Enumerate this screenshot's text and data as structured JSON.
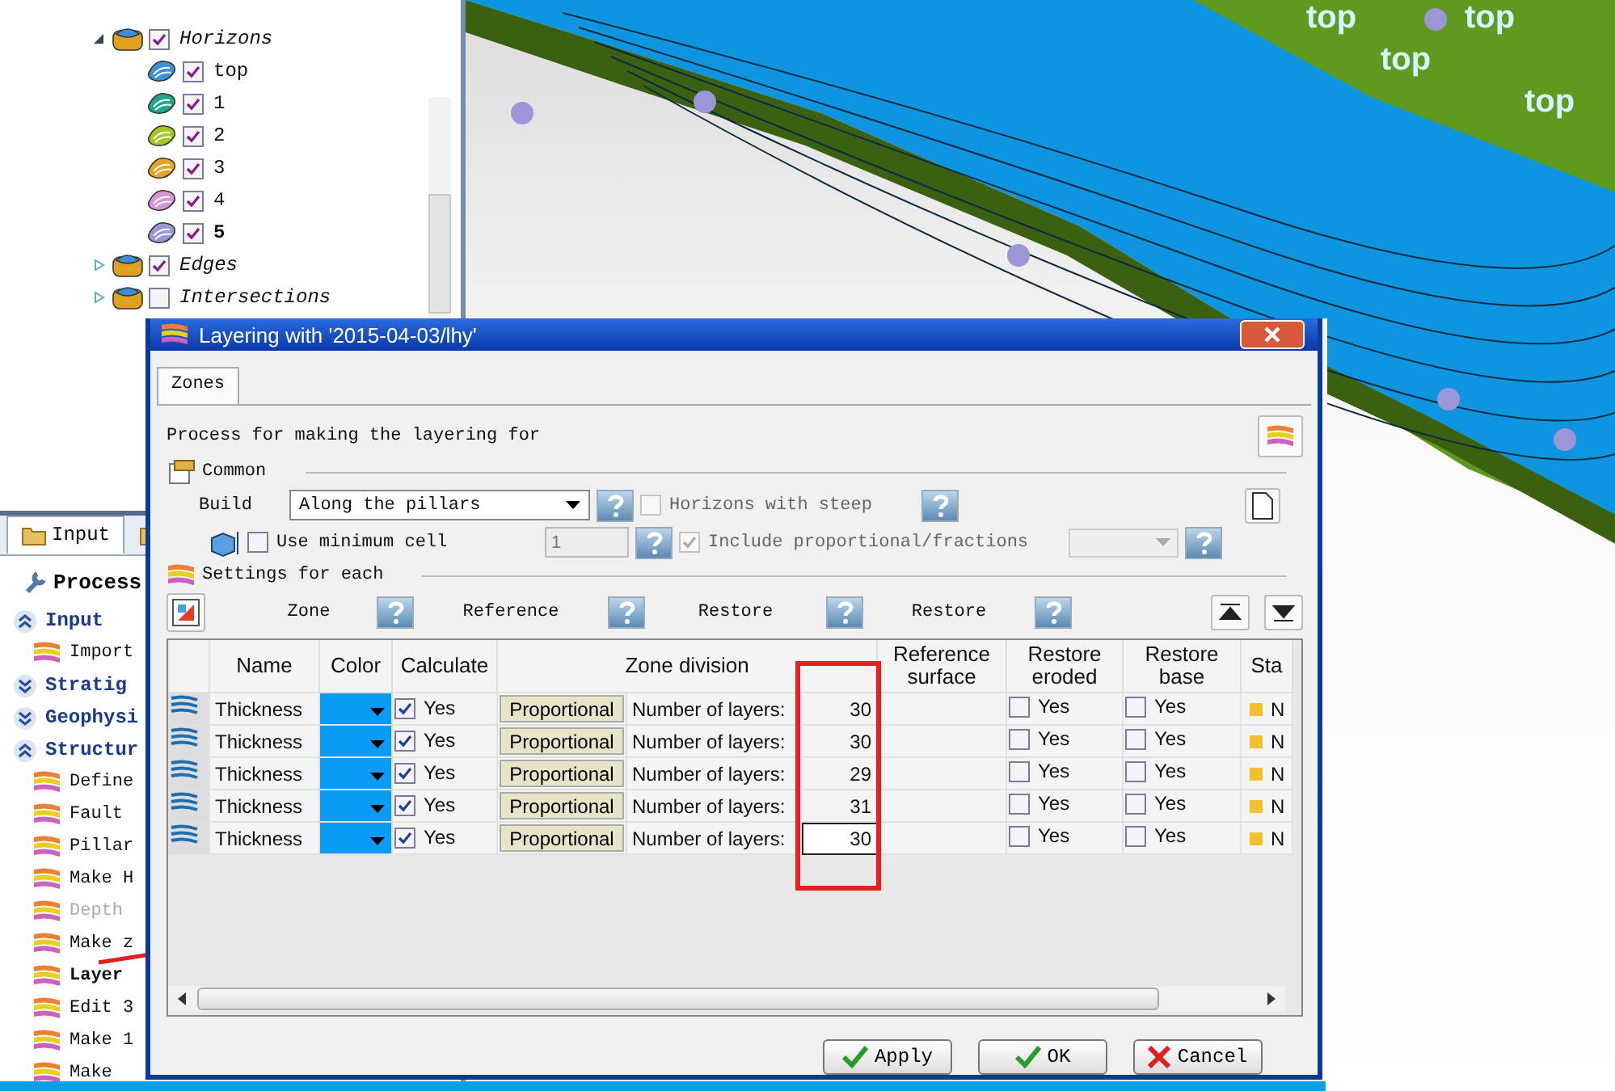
{
  "tree": {
    "items": [
      {
        "label": "Horizons",
        "kind": "folder",
        "checked": true,
        "expanded": true,
        "active": false,
        "children": [
          {
            "label": "top",
            "kind": "horizon",
            "checked": true,
            "active": false,
            "color": "#3a8fd8"
          },
          {
            "label": "1",
            "kind": "horizon",
            "checked": true,
            "active": false,
            "color": "#1fa88f"
          },
          {
            "label": "2",
            "kind": "horizon",
            "checked": true,
            "active": false,
            "color": "#a6c81e"
          },
          {
            "label": "3",
            "kind": "horizon",
            "checked": true,
            "active": false,
            "color": "#e2a422"
          },
          {
            "label": "4",
            "kind": "horizon",
            "checked": true,
            "active": false,
            "color": "#d894d8"
          },
          {
            "label": "5",
            "kind": "horizon",
            "checked": true,
            "active": true,
            "color": "#9a96d8"
          }
        ]
      },
      {
        "label": "Edges",
        "kind": "folder",
        "checked": true,
        "expanded": false,
        "active": false
      },
      {
        "label": "Intersections",
        "kind": "folder",
        "checked": false,
        "expanded": false,
        "active": false
      }
    ]
  },
  "process_panel": {
    "tabs": [
      {
        "label": "Input",
        "selected": true
      },
      {
        "selected": false
      }
    ],
    "title": "Process",
    "sections": [
      {
        "label": "Input",
        "expanded": true,
        "items": [
          {
            "label": "Import",
            "selected": false,
            "disabled": false
          }
        ]
      },
      {
        "label": "Stratig",
        "expanded": false
      },
      {
        "label": "Geophysi",
        "expanded": false
      },
      {
        "label": "Structur",
        "expanded": true,
        "items": [
          {
            "label": "Define",
            "selected": false,
            "disabled": false
          },
          {
            "label": "Fault",
            "selected": false,
            "disabled": false
          },
          {
            "label": "Pillar",
            "selected": false,
            "disabled": false
          },
          {
            "label": "Make H",
            "selected": false,
            "disabled": false
          },
          {
            "label": "Depth",
            "selected": false,
            "disabled": true
          },
          {
            "label": "Make z",
            "selected": false,
            "disabled": false
          },
          {
            "label": "Layer",
            "selected": true,
            "disabled": false
          },
          {
            "label": "Edit 3",
            "selected": false,
            "disabled": false
          },
          {
            "label": "Make 1",
            "selected": false,
            "disabled": false
          },
          {
            "label": "Make",
            "selected": false,
            "disabled": false
          }
        ]
      }
    ]
  },
  "viewport": {
    "labels": [
      "top",
      "top",
      "top",
      "top"
    ]
  },
  "dialog": {
    "title": "Layering with '2015-04-03/lhy'",
    "tabs": [
      {
        "label": "Zones",
        "selected": true
      }
    ],
    "intro": "Process for making the layering for",
    "common": {
      "heading": "Common",
      "build_label": "Build",
      "build_value": "Along the pillars",
      "horizons_steep": {
        "label": "Horizons with steep",
        "checked": false,
        "disabled": true
      },
      "min_cell": {
        "label": "Use minimum cell",
        "checked": false,
        "disabled": false
      },
      "min_cell_value": {
        "value": "1",
        "disabled": true
      },
      "include_prop": {
        "label": "Include proportional/fractions",
        "checked": true,
        "disabled": true
      }
    },
    "settings": {
      "heading": "Settings for each",
      "toolbar_labels": [
        "Zone",
        "Reference",
        "Restore",
        "Restore"
      ]
    },
    "table": {
      "columns": [
        "Name",
        "Color",
        "Calculate",
        "Zone division",
        "Reference surface",
        "Restore eroded",
        "Restore base",
        "Sta"
      ],
      "rows": [
        {
          "name": "Thickness",
          "color": "#0a9cf5",
          "calculate": {
            "label": "Yes",
            "checked": true
          },
          "method": "Proportional",
          "division_label": "Number of layers:",
          "value": "30",
          "focused": false,
          "eroded": {
            "label": "Yes",
            "checked": false
          },
          "base": {
            "label": "Yes",
            "checked": false
          },
          "status": "N"
        },
        {
          "name": "Thickness",
          "color": "#0a9cf5",
          "calculate": {
            "label": "Yes",
            "checked": true
          },
          "method": "Proportional",
          "division_label": "Number of layers:",
          "value": "30",
          "focused": false,
          "eroded": {
            "label": "Yes",
            "checked": false
          },
          "base": {
            "label": "Yes",
            "checked": false
          },
          "status": "N"
        },
        {
          "name": "Thickness",
          "color": "#0a9cf5",
          "calculate": {
            "label": "Yes",
            "checked": true
          },
          "method": "Proportional",
          "division_label": "Number of layers:",
          "value": "29",
          "focused": false,
          "eroded": {
            "label": "Yes",
            "checked": false
          },
          "base": {
            "label": "Yes",
            "checked": false
          },
          "status": "N"
        },
        {
          "name": "Thickness",
          "color": "#0a9cf5",
          "calculate": {
            "label": "Yes",
            "checked": true
          },
          "method": "Proportional",
          "division_label": "Number of layers:",
          "value": "31",
          "focused": false,
          "eroded": {
            "label": "Yes",
            "checked": false
          },
          "base": {
            "label": "Yes",
            "checked": false
          },
          "status": "N"
        },
        {
          "name": "Thickness",
          "color": "#0a9cf5",
          "calculate": {
            "label": "Yes",
            "checked": true
          },
          "method": "Proportional",
          "division_label": "Number of layers:",
          "value": "30",
          "focused": true,
          "eroded": {
            "label": "Yes",
            "checked": false
          },
          "base": {
            "label": "Yes",
            "checked": false
          },
          "status": "N"
        }
      ]
    },
    "buttons": [
      {
        "label": "Apply",
        "kind": "confirm"
      },
      {
        "label": "OK",
        "kind": "confirm"
      },
      {
        "label": "Cancel",
        "kind": "cancel"
      }
    ]
  }
}
